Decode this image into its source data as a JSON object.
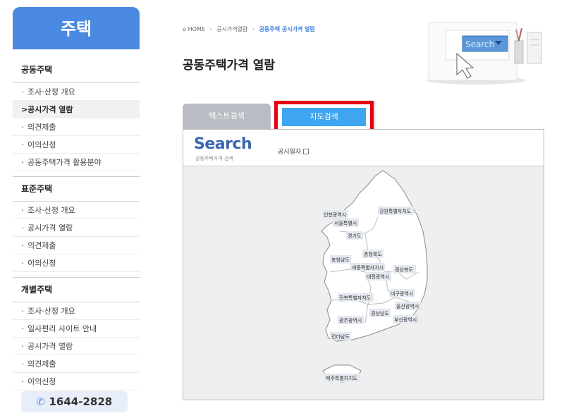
{
  "sidebar": {
    "title": "주택",
    "groups": [
      {
        "title": "공동주택",
        "items": [
          {
            "label": "조사·산정 개요",
            "bullet": "·"
          },
          {
            "label": "공시가격 열람",
            "bullet": ">"
          },
          {
            "label": "의견제출",
            "bullet": "·"
          },
          {
            "label": "이의신청",
            "bullet": "·"
          },
          {
            "label": "공동주택가격 활용분야",
            "bullet": "·"
          }
        ]
      },
      {
        "title": "표준주택",
        "items": [
          {
            "label": "조사·산정 개요",
            "bullet": "·"
          },
          {
            "label": "공시가격 열람",
            "bullet": "·"
          },
          {
            "label": "의견제출",
            "bullet": "·"
          },
          {
            "label": "이의신청",
            "bullet": "·"
          }
        ]
      },
      {
        "title": "개별주택",
        "items": [
          {
            "label": "조사·산정 개요",
            "bullet": "·"
          },
          {
            "label": "일사편리 사이트 안내",
            "bullet": "·"
          },
          {
            "label": "공시가격 열람",
            "bullet": "·"
          },
          {
            "label": "의견제출",
            "bullet": "·"
          },
          {
            "label": "이의신청",
            "bullet": "·"
          }
        ]
      }
    ],
    "phone": "1644-2828",
    "phone_icon": "phone-icon"
  },
  "breadcrumb": {
    "home": "HOME",
    "home_icon": "home-icon",
    "level1": "공시가격열람",
    "current": "공동주택 공시가격 열람"
  },
  "page_title": "공동주택가격 열람",
  "illustration": {
    "search_text": "Search"
  },
  "tabs": {
    "text_search": "텍스트검색",
    "map_search": "지도검색"
  },
  "search": {
    "title": "Search",
    "subtitle": "공동주택가격 검색",
    "date_label": "공시일자"
  },
  "regions": [
    "인천광역시",
    "강원특별자치도",
    "서울특별시",
    "경기도",
    "충청북도",
    "충청남도",
    "세종특별자치시",
    "경상북도",
    "대전광역시",
    "대구광역시",
    "전북특별자치도",
    "울산광역시",
    "경상남도",
    "광주광역시",
    "부산광역시",
    "전라남도",
    "제주특별자치도"
  ],
  "colors": {
    "accent": "#4a89e2",
    "tab_active": "#3ea5f0",
    "highlight": "#e60012"
  }
}
